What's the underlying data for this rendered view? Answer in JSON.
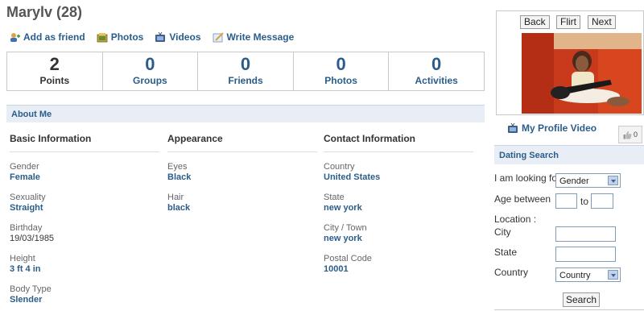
{
  "profile": {
    "title": "Marylv (28)"
  },
  "actions": [
    {
      "label": "Add as friend",
      "icon": "add-friend-icon"
    },
    {
      "label": "Photos",
      "icon": "photos-icon"
    },
    {
      "label": "Videos",
      "icon": "videos-icon"
    },
    {
      "label": "Write Message",
      "icon": "write-message-icon"
    }
  ],
  "stats": [
    {
      "value": "2",
      "label": "Points"
    },
    {
      "value": "0",
      "label": "Groups"
    },
    {
      "value": "0",
      "label": "Friends"
    },
    {
      "value": "0",
      "label": "Photos"
    },
    {
      "value": "0",
      "label": "Activities"
    }
  ],
  "about": {
    "heading": "About Me"
  },
  "basic": {
    "heading": "Basic Information",
    "fields": [
      {
        "label": "Gender",
        "value": "Female"
      },
      {
        "label": "Sexuality",
        "value": "Straight"
      },
      {
        "label": "Birthday",
        "value": "19/03/1985"
      },
      {
        "label": "Height",
        "value": "3 ft 4 in"
      },
      {
        "label": "Body Type",
        "value": "Slender"
      }
    ]
  },
  "appearance": {
    "heading": "Appearance",
    "fields": [
      {
        "label": "Eyes",
        "value": "Black"
      },
      {
        "label": "Hair",
        "value": "black"
      }
    ]
  },
  "contact": {
    "heading": "Contact Information",
    "fields": [
      {
        "label": "Country",
        "value": "United States"
      },
      {
        "label": "State",
        "value": "new york"
      },
      {
        "label": "City / Town",
        "value": "new york"
      },
      {
        "label": "Postal Code",
        "value": "10001"
      }
    ]
  },
  "photo_nav": {
    "back": "Back",
    "flirt": "Flirt",
    "next": "Next"
  },
  "video": {
    "label": "My Profile Video"
  },
  "like": {
    "count": "0"
  },
  "dating_search": {
    "heading": "Dating Search",
    "looking_for_label": "I am looking for",
    "looking_for_value": "Gender",
    "age_label": "Age between",
    "age_to": "to",
    "location_label": "Location :",
    "city_label": "City",
    "state_label": "State",
    "country_label": "Country",
    "country_value": "Country",
    "search_button": "Search"
  },
  "colors": {
    "link_blue": "#2a5d8a",
    "header_bg": "#e9eef6"
  }
}
